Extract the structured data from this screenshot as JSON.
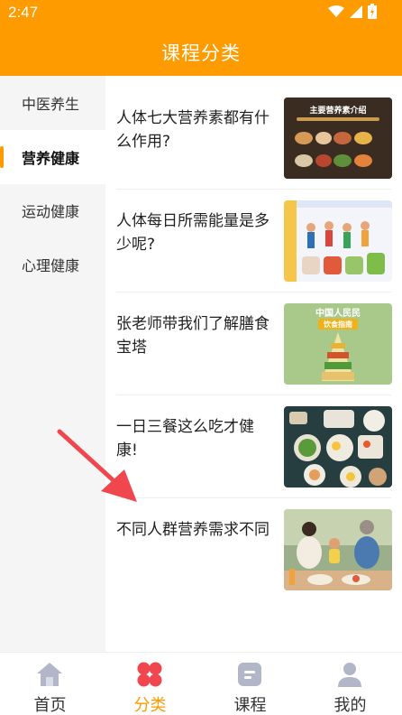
{
  "status": {
    "time": "2:47"
  },
  "header": {
    "title": "课程分类"
  },
  "sidebar": {
    "items": [
      {
        "label": "中医养生",
        "active": false
      },
      {
        "label": "营养健康",
        "active": true
      },
      {
        "label": "运动健康",
        "active": false
      },
      {
        "label": "心理健康",
        "active": false
      }
    ]
  },
  "courses": [
    {
      "title": "人体七大营养素都有什么作用?",
      "thumb_text": "主要营养素介绍"
    },
    {
      "title": "人体每日所需能量是多少呢?",
      "thumb_text": ""
    },
    {
      "title": "张老师带我们了解膳食宝塔",
      "thumb_text": "中国人民民\n饮食指南"
    },
    {
      "title": "一日三餐这么吃才健康!",
      "thumb_text": ""
    },
    {
      "title": "不同人群营养需求不同",
      "thumb_text": ""
    }
  ],
  "tabbar": {
    "items": [
      {
        "label": "首页",
        "icon": "home-icon",
        "active": false
      },
      {
        "label": "分类",
        "icon": "category-icon",
        "active": true
      },
      {
        "label": "课程",
        "icon": "course-icon",
        "active": false
      },
      {
        "label": "我的",
        "icon": "profile-icon",
        "active": false
      }
    ]
  },
  "colors": {
    "accent": "#fd9b00",
    "arrow": "#f0474f"
  }
}
